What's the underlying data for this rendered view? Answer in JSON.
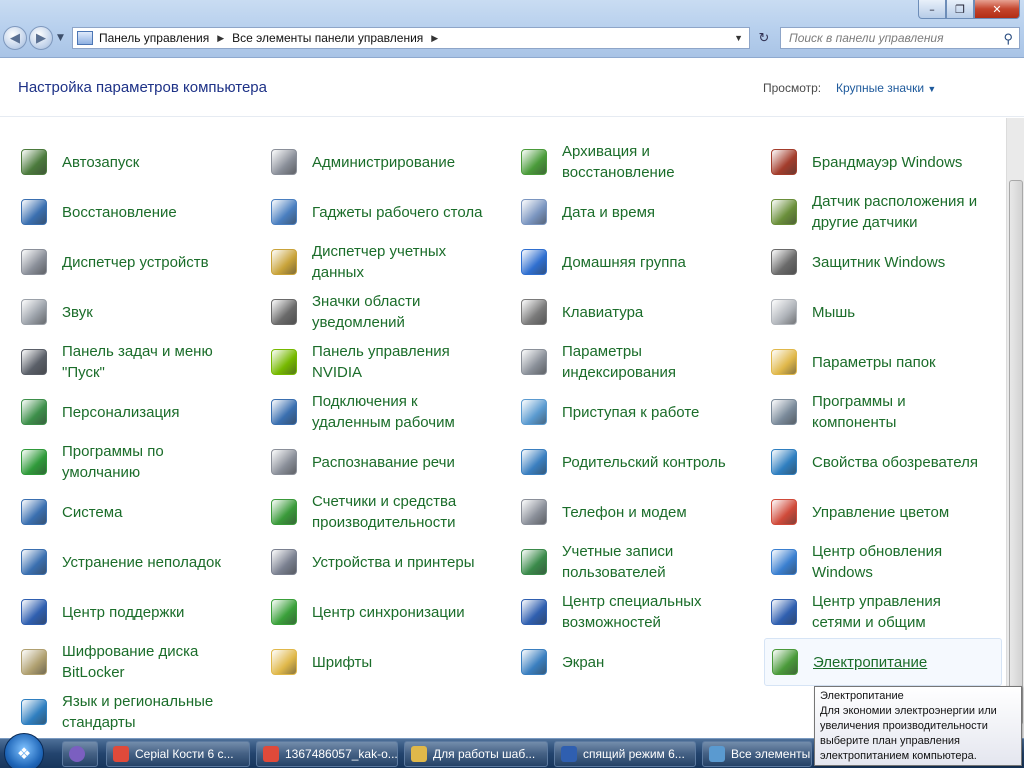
{
  "address": {
    "crumbs": [
      "Панель управления",
      "Все элементы панели управления"
    ],
    "search_placeholder": "Поиск в панели управления"
  },
  "header": {
    "title": "Настройка параметров компьютера",
    "view_by_label": "Просмотр:",
    "view_by_value": "Крупные значки"
  },
  "items": [
    {
      "label": "Автозапуск",
      "icon": "autoplay-icon",
      "color": "#4b7a3c"
    },
    {
      "label": "Администрирование",
      "icon": "admin-tools-icon",
      "color": "#8a8f99"
    },
    {
      "label": "Архивация и восстановление",
      "icon": "backup-icon",
      "color": "#4a9b3a"
    },
    {
      "label": "Брандмауэр Windows",
      "icon": "firewall-icon",
      "color": "#a33d2c"
    },
    {
      "label": "Восстановление",
      "icon": "recovery-icon",
      "color": "#3a6fb0"
    },
    {
      "label": "Гаджеты рабочего стола",
      "icon": "gadgets-icon",
      "color": "#4a7fc0"
    },
    {
      "label": "Дата и время",
      "icon": "calendar-icon",
      "color": "#7a95c0"
    },
    {
      "label": "Датчик расположения и другие датчики",
      "icon": "sensor-icon",
      "color": "#6a8f3a"
    },
    {
      "label": "Диспетчер устройств",
      "icon": "device-manager-icon",
      "color": "#8a8f99"
    },
    {
      "label": "Диспетчер учетных данных",
      "icon": "credential-icon",
      "color": "#c9a33a"
    },
    {
      "label": "Домашняя группа",
      "icon": "homegroup-icon",
      "color": "#2f6fd0"
    },
    {
      "label": "Защитник Windows",
      "icon": "defender-icon",
      "color": "#6a6a6a"
    },
    {
      "label": "Звук",
      "icon": "speaker-icon",
      "color": "#9aa0a8"
    },
    {
      "label": "Значки области уведомлений",
      "icon": "notification-icon",
      "color": "#6a6a6a"
    },
    {
      "label": "Клавиатура",
      "icon": "keyboard-icon",
      "color": "#7a7a7a"
    },
    {
      "label": "Мышь",
      "icon": "mouse-icon",
      "color": "#b0b4ba"
    },
    {
      "label": "Панель задач и меню \"Пуск\"",
      "icon": "taskbar-icon",
      "color": "#5a5f68"
    },
    {
      "label": "Панель управления NVIDIA",
      "icon": "nvidia-icon",
      "color": "#76b900"
    },
    {
      "label": "Параметры индексирования",
      "icon": "indexing-icon",
      "color": "#8a9099"
    },
    {
      "label": "Параметры папок",
      "icon": "folder-options-icon",
      "color": "#e0b84a"
    },
    {
      "label": "Персонализация",
      "icon": "personalization-icon",
      "color": "#3d8f4a"
    },
    {
      "label": "Подключения к удаленным рабочим",
      "icon": "remote-desktop-icon",
      "color": "#3a6fb0"
    },
    {
      "label": "Приступая к работе",
      "icon": "getting-started-icon",
      "color": "#5a9ad0"
    },
    {
      "label": "Программы и компоненты",
      "icon": "programs-icon",
      "color": "#7a8a9a"
    },
    {
      "label": "Программы по умолчанию",
      "icon": "default-programs-icon",
      "color": "#2f9a3a"
    },
    {
      "label": "Распознавание речи",
      "icon": "microphone-icon",
      "color": "#8a8f99"
    },
    {
      "label": "Родительский контроль",
      "icon": "parental-control-icon",
      "color": "#3a7fc0"
    },
    {
      "label": "Свойства обозревателя",
      "icon": "internet-options-icon",
      "color": "#2f7fc0"
    },
    {
      "label": "Система",
      "icon": "system-icon",
      "color": "#3a6fb0"
    },
    {
      "label": "Счетчики и средства производительности",
      "icon": "performance-icon",
      "color": "#3a9a3a"
    },
    {
      "label": "Телефон и модем",
      "icon": "phone-modem-icon",
      "color": "#8a8f99"
    },
    {
      "label": "Управление цветом",
      "icon": "color-management-icon",
      "color": "#d04a3a"
    },
    {
      "label": "Устранение неполадок",
      "icon": "troubleshooting-icon",
      "color": "#3a6fb0"
    },
    {
      "label": "Устройства и принтеры",
      "icon": "printer-icon",
      "color": "#7a8090"
    },
    {
      "label": "Учетные записи пользователей",
      "icon": "user-accounts-icon",
      "color": "#3a8a4a"
    },
    {
      "label": "Центр обновления Windows",
      "icon": "windows-update-icon",
      "color": "#3a7fd0"
    },
    {
      "label": "Центр поддержки",
      "icon": "action-center-icon",
      "color": "#2f5fb0"
    },
    {
      "label": "Центр синхронизации",
      "icon": "sync-center-icon",
      "color": "#3aa03a"
    },
    {
      "label": "Центр специальных возможностей",
      "icon": "accessibility-icon",
      "color": "#2f5fb0"
    },
    {
      "label": "Центр управления сетями и общим",
      "icon": "network-icon",
      "color": "#2f5fb0"
    },
    {
      "label": "Шифрование диска BitLocker",
      "icon": "bitlocker-icon",
      "color": "#b0a070"
    },
    {
      "label": "Шрифты",
      "icon": "fonts-icon",
      "color": "#e0b84a"
    },
    {
      "label": "Экран",
      "icon": "display-icon",
      "color": "#3a7fc0"
    },
    {
      "label": "Электропитание",
      "icon": "power-options-icon",
      "color": "#4a9a3a"
    },
    {
      "label": "Язык и региональные стандарты",
      "icon": "region-icon",
      "color": "#2f7fc0"
    }
  ],
  "tooltip": {
    "title": "Электропитание",
    "text": "Для экономии электроэнергии или увеличения производительности выберите план управления электропитанием компьютера."
  },
  "taskbar": {
    "items": [
      {
        "label": "Серial Кости 6 с...",
        "icon": "chrome-icon",
        "color": "#e04a3a"
      },
      {
        "label": "1367486057_kak-o...",
        "icon": "chrome-icon",
        "color": "#e04a3a"
      },
      {
        "label": "Для работы шаб...",
        "icon": "folder-icon",
        "color": "#e0b84a"
      },
      {
        "label": "спящий режим 6...",
        "icon": "word-icon",
        "color": "#2f5fb0"
      },
      {
        "label": "Все элементы ...",
        "icon": "control-panel-icon",
        "color": "#5a9ad0"
      }
    ]
  }
}
